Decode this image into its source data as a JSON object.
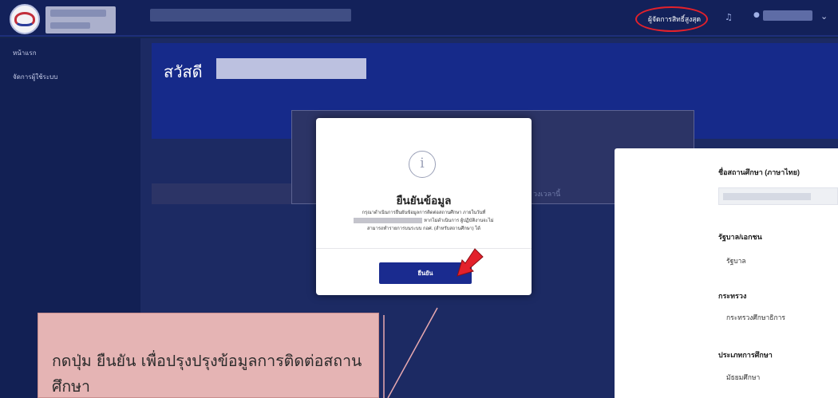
{
  "header": {
    "role_label": "ผู้จัดการสิทธิ์สูงสุด",
    "bell_icon": "bell-icon",
    "user_icon": "user-icon",
    "chevron_icon": "chevron-down-icon"
  },
  "sidebar": {
    "items": [
      {
        "label": "หน้าแรก"
      },
      {
        "label": "จัดการผู้ใช้ระบบ"
      }
    ]
  },
  "main": {
    "greeting": "สวัสดี",
    "background_text": "วงเวลานี้"
  },
  "modal": {
    "icon": "info-icon",
    "title": "ยืนยันข้อมูล",
    "body_line1": "กรุณาดำเนินการยืนยันข้อมูลการติดต่อสถานศึกษา ภายในวันที่",
    "body_line2": "หากไม่ดำเนินการ ผู้ปฏิบัติงานจะไม่",
    "body_line3": "สามารถทำรายการบนระบบ กอศ. (สำหรับสถานศึกษา) ได้",
    "confirm_label": "ยืนยัน"
  },
  "callout": {
    "text": "กดปุ่ม ยืนยัน เพื่อปรุงปรุงข้อมูลการติดต่อสถานศึกษา"
  },
  "right_panel": {
    "fields": [
      {
        "label": "ชื่อสถานศึกษา (ภาษาไทย)",
        "value": ""
      },
      {
        "label": "รัฐบาล/เอกชน",
        "value": "รัฐบาล"
      },
      {
        "label": "กระทรวง",
        "value": "กระทรวงศึกษาธิการ"
      },
      {
        "label": "ประเภทการศึกษา",
        "value": "มัธยมศึกษา"
      }
    ]
  },
  "colors": {
    "topbar": "#13215a",
    "sidebar": "#122054",
    "hero": "#162a8a",
    "accent_button": "#1a2b8f",
    "highlight_red": "#e3212b",
    "callout_bg": "#e5b4b4"
  }
}
